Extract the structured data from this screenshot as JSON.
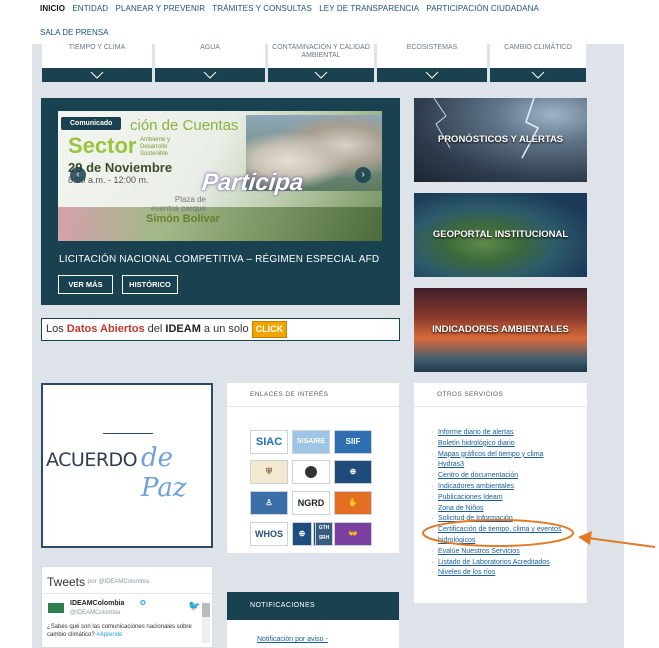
{
  "nav": {
    "items": [
      "INICIO",
      "ENTIDAD",
      "PLANEAR Y PREVENIR",
      "TRÁMITES Y CONSULTAS",
      "LEY DE TRANSPARENCIA",
      "PARTICIPACIÓN CIUDADANA"
    ],
    "sub": "SALA DE PRENSA"
  },
  "categories": [
    {
      "label": "TIEMPO Y CLIMA"
    },
    {
      "label": "AGUA"
    },
    {
      "label": "CONTAMINACIÓN Y CALIDAD AMBIENTAL"
    },
    {
      "label": "ECOSISTEMAS"
    },
    {
      "label": "CAMBIO CLIMÁTICO"
    }
  ],
  "banner": {
    "tag": "Comunicado",
    "line1": "ción de Cuentas",
    "line2": "Sector",
    "line2_sub": "Ambiente y Desarrollo Sostenible",
    "date": "29 de Noviembre",
    "time": "8:00 a.m. - 12:00 m.",
    "participa": "Participa",
    "place": "Plaza de eventos parque",
    "park": "Simón Bolívar",
    "title": "LICITACIÓN NACIONAL COMPETITIVA – RÉGIMEN ESPECIAL AFD",
    "btn_more": "VER MÁS",
    "btn_history": "HISTÓRICO",
    "prev": "‹",
    "next": "›"
  },
  "opendata": {
    "pre": "Los ",
    "red": "Datos Abiertos",
    "mid": " del ",
    "bold": "IDEAM",
    "post": " a un solo ",
    "click": "CLICK"
  },
  "tiles": [
    {
      "label": "PRONÓSTICOS Y ALERTAS"
    },
    {
      "label": "GEOPORTAL INSTITUCIONAL"
    },
    {
      "label": "INDICADORES AMBIENTALES"
    }
  ],
  "peace": {
    "word1": "ACUERDO",
    "word2": "de Paz"
  },
  "links": {
    "header": "ENLACES DE INTERÉS",
    "logos": [
      "SIAC",
      "SISAIRE",
      "SIIF",
      "",
      "",
      "",
      "",
      "NGRD",
      "",
      "WHOS",
      "",
      "",
      "GTH SRH",
      ""
    ]
  },
  "services": {
    "header": "OTROS SERVICIOS",
    "items": [
      "Informe diario de alertas",
      "Boletín hidrológico diario",
      "Mapas gráficos del tiempo y clima",
      "Hydras3",
      "Centro de documentación",
      "Indicadores ambientales",
      "Publicaciones Ideam",
      "Zona de Niños",
      "Solicitud de Información",
      "Certificación de tiempo, clima y eventos hidrológicos",
      "Evalúe Nuestros Servicios",
      "Listado de Laboratorios Acreditados",
      "Niveles de los ríos"
    ]
  },
  "tweets": {
    "title": "Tweets",
    "by": "por @IDEAMColombia",
    "name": "IDEAMColombia",
    "handle": "@IDEAMColombia",
    "text": "¿Sabes qué son las comunicaciones nacionales sobre cambio climático?",
    "tag": "#Aprende"
  },
  "notifications": {
    "header": "NOTIFICACIONES",
    "item": "Notificación por aviso -"
  },
  "colors": {
    "dark": "#19414f",
    "accent": "#e07a26",
    "link": "#1a5c9a"
  }
}
